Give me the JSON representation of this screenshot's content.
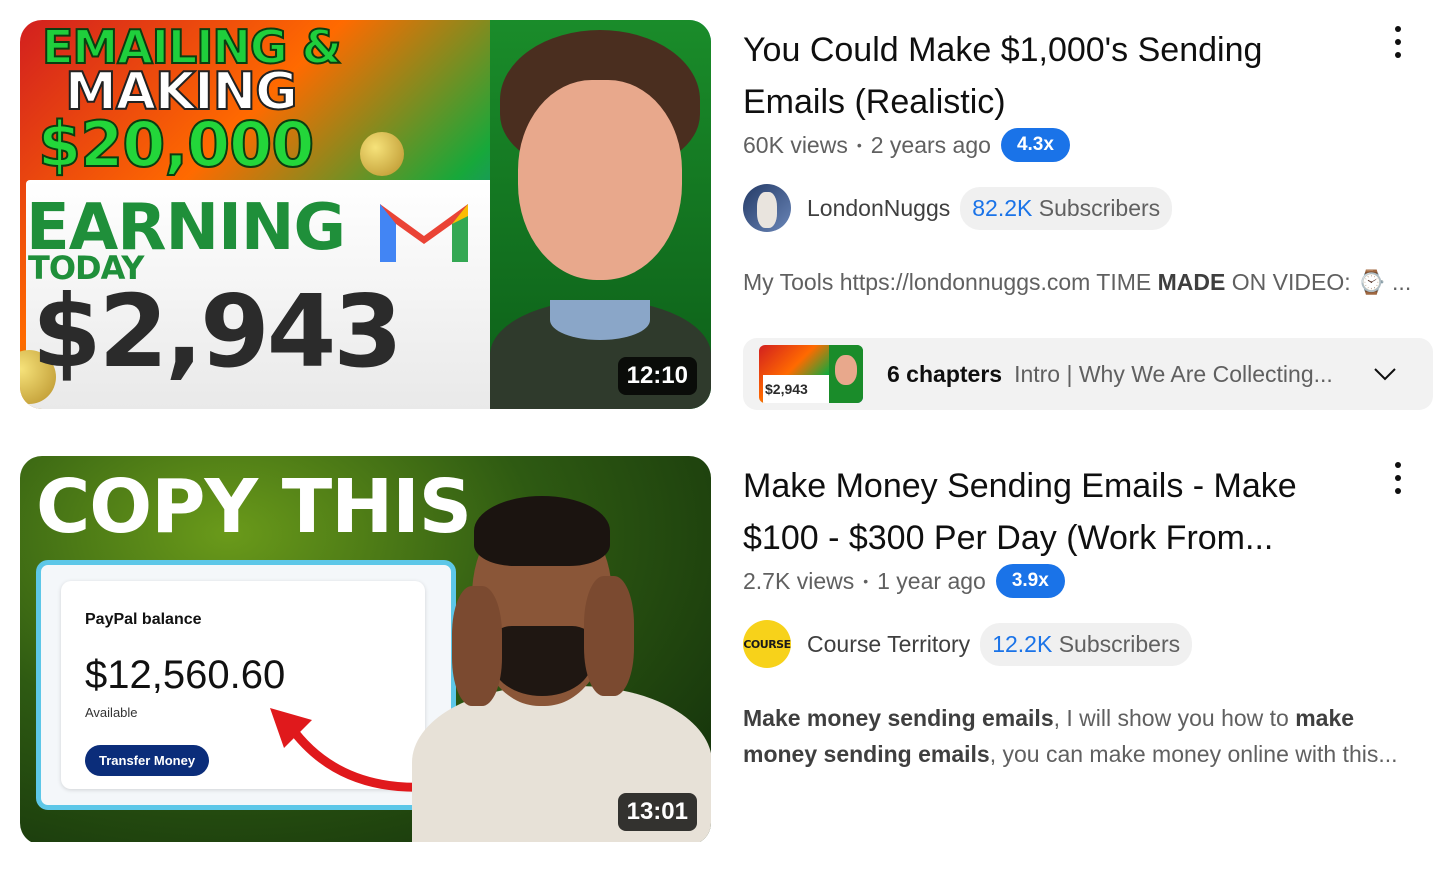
{
  "results": [
    {
      "thumbnail": {
        "duration": "12:10",
        "lines": [
          "EMAILING &",
          "MAKING",
          "$20,000",
          "EARNING",
          "TODAY",
          "$2,943"
        ]
      },
      "title": "You Could Make $1,000's Sending Emails (Realistic)",
      "views": "60K views",
      "age": "2 years ago",
      "speed_badge": "4.3x",
      "channel": {
        "name": "LondonNuggs",
        "subs_count": "82.2K",
        "subs_label": "Subscribers"
      },
      "description": {
        "pre": "My Tools https://londonnuggs.com TIME ",
        "bold": "MADE",
        "post": " ON VIDEO: ⌚ ..."
      },
      "chapters": {
        "count": "6 chapters",
        "text": "Intro | Why We Are Collecting...",
        "thumb_text": "$2,943"
      }
    },
    {
      "thumbnail": {
        "duration": "13:01",
        "headline": "COPY THIS",
        "card_title": "PayPal balance",
        "card_amount": "$12,560.60",
        "card_available": "Available",
        "card_button": "Transfer Money"
      },
      "title": "Make Money Sending Emails - Make $100 - $300 Per Day (Work From...",
      "views": "2.7K views",
      "age": "1 year ago",
      "speed_badge": "3.9x",
      "channel": {
        "name": "Course Territory",
        "avatar_text": "COURSE",
        "subs_count": "12.2K",
        "subs_label": "Subscribers"
      },
      "description": {
        "b1": "Make money sending emails",
        "t1": ", I will show you how to ",
        "b2": "make money sending emails",
        "t2": ", you can make money online with this..."
      }
    }
  ],
  "colors": {
    "accent_blue": "#1a73e8",
    "text_primary": "#0f0f0f",
    "text_secondary": "#606060"
  }
}
